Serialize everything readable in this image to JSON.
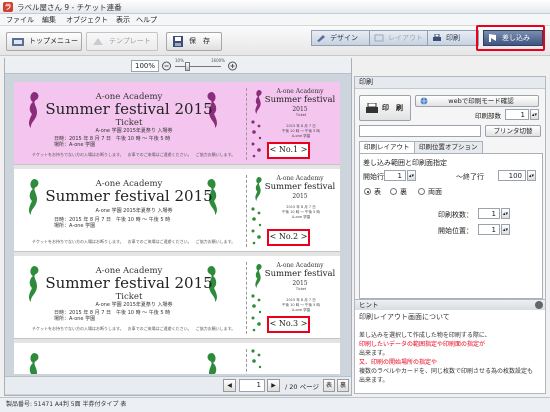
{
  "window": {
    "title": "ラベル屋さん 9 - チケット連番",
    "app_icon": "ラ"
  },
  "menu": [
    "ファイル",
    "編集",
    "オブジェクト",
    "表示",
    "ヘルプ"
  ],
  "toolbar": {
    "top_menu": "トップメニュー",
    "template": "テンプレート",
    "save": "保　存"
  },
  "steps": [
    "デザイン",
    "レイアウト",
    "印刷",
    "差し込み"
  ],
  "zoom": {
    "value": "100%",
    "min_label": "10%",
    "max_label": "1600%"
  },
  "colors": {
    "accent_red": "#e8001c",
    "ticket_pink": "#f4c6ef",
    "seahorse_pink": "#8a2d7a",
    "seahorse_green": "#2e8b3c"
  },
  "tickets": [
    {
      "academy": "A-one Academy",
      "festival": "Summer festival 2015",
      "ticket": "Ticket",
      "admission": "A-one 学園 2015年夏祭り 入場券",
      "date": "日時：2015 年 8 月 7 日　午後 10 時 〜 午後 5 時",
      "place": "場所：A-one 学園",
      "note": "チケットをお持ちでない方の入場はお断りします。　お車でのご来場はご遠慮ください。　ご協力お願いします。",
      "stub_academy": "A-one Academy",
      "stub_festival": "Summer festival",
      "stub_year": "2015",
      "stub_ticket": "Ticket",
      "stub_l1": "2015 年 8 月 7 日",
      "stub_l2": "午後 10 時 〜 午後 5 時",
      "stub_l3": "A-one 学園",
      "number": "< No.1 >",
      "theme": "pink"
    },
    {
      "academy": "A-one Academy",
      "festival": "Summer festival 2015",
      "ticket": "",
      "admission": "A-one 学園 2015年夏祭り 入場券",
      "date": "日時：2015 年 8 月 7 日　午後 10 時 〜 午後 5 時",
      "place": "場所：A-one 学園",
      "note": "チケットをお持ちでない方の入場はお断りします。　お車でのご来場はご遠慮ください。　ご協力お願いします。",
      "stub_academy": "A-one Academy",
      "stub_festival": "Summer festival",
      "stub_year": "2015",
      "stub_ticket": "",
      "stub_l1": "2015 年 8 月 7 日",
      "stub_l2": "午後 10 時 〜 午後 5 時",
      "stub_l3": "A-one 学園",
      "number": "< No.2 >",
      "theme": "green"
    },
    {
      "academy": "A-one Academy",
      "festival": "Summer festival 2015",
      "ticket": "Ticket",
      "admission": "A-one 学園 2015年夏祭り 入場券",
      "date": "日時：2015 年 8 月 7 日　午後 10 時 〜 午後 5 時",
      "place": "場所：A-one 学園",
      "note": "チケットをお持ちでない方の入場はお断りします。　お車でのご来場はご遠慮ください。　ご協力お願いします。",
      "stub_academy": "A-one Academy",
      "stub_festival": "Summer festival",
      "stub_year": "2015",
      "stub_ticket": "Ticket",
      "stub_l1": "2015 年 8 月 7 日",
      "stub_l2": "午後 10 時 〜 午後 5 時",
      "stub_l3": "A-one 学園",
      "number": "< No.3 >",
      "theme": "green"
    },
    {
      "academy": "",
      "festival": "",
      "ticket": "",
      "admission": "",
      "date": "",
      "place": "",
      "note": "",
      "stub_academy": "",
      "stub_festival": "",
      "stub_year": "",
      "stub_ticket": "",
      "stub_l1": "",
      "stub_l2": "",
      "stub_l3": "",
      "number": "",
      "theme": "green"
    }
  ],
  "pager": {
    "page": "1",
    "total": "/ 20 ページ",
    "front": "表",
    "back": "裏"
  },
  "status": "製品番号: 51471 A4判 5面 半券付タイプ 表",
  "print_panel": {
    "header": "印刷",
    "print_button": "印　刷",
    "web_mode": "webで印刷モード確認",
    "copies_label": "印刷部数",
    "copies": "1",
    "printer_value": "",
    "printer_button": "プリンタ切替",
    "tabs": [
      "印刷レイアウト",
      "印刷位置オプション"
    ],
    "range_title": "差し込み範囲と印刷面指定",
    "start_label": "開始行",
    "start": "1",
    "end_label": "〜終了行",
    "end": "100",
    "side_front": "表",
    "side_back": "裏",
    "side_both": "両面",
    "sheets_label": "印刷枚数：",
    "sheets": "1",
    "start_pos_label": "開始位置：",
    "start_pos": "1"
  },
  "hint": {
    "header": "ヒント",
    "title": "印刷レイアウト画面について",
    "l1": "差し込みを選択して作成した物を印刷する際に、",
    "l2": "印刷したいデータの範囲指定や印刷面の指定が",
    "l3": "出来ます。",
    "l4": "又、印刷の開始場所の指定や",
    "l5": "複数のラベルやカードを、同じ枚数で印刷させる為の枚数設定も",
    "l6": "出来ます。"
  }
}
